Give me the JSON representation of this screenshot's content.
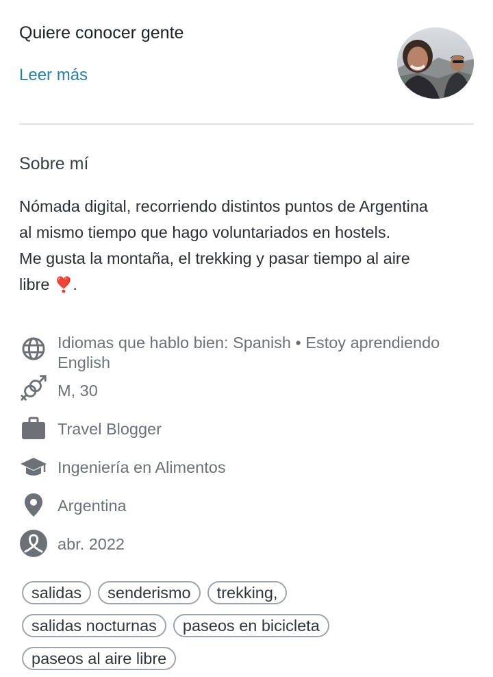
{
  "header": {
    "headline": "Quiere conocer gente",
    "read_more": "Leer más"
  },
  "about": {
    "title": "Sobre mí",
    "lines": [
      "Nómada digital, recorriendo distintos puntos de Argentina",
      "al mismo tiempo que hago voluntariados en hostels.",
      "Me gusta la montaña, el trekking y pasar tiempo al aire",
      "libre"
    ],
    "emoji": "❣️",
    "end": "."
  },
  "details": [
    {
      "icon": "globe-icon",
      "lines": [
        "Idiomas que hablo bien: Spanish • Estoy aprendiendo",
        "English"
      ]
    },
    {
      "icon": "gender-icon",
      "lines": [
        "M, 30"
      ]
    },
    {
      "icon": "briefcase-icon",
      "lines": [
        "Travel Blogger"
      ]
    },
    {
      "icon": "graduation-cap-icon",
      "lines": [
        "Ingeniería en Alimentos"
      ]
    },
    {
      "icon": "location-pin-icon",
      "lines": [
        "Argentina"
      ]
    },
    {
      "icon": "member-since-icon",
      "lines": [
        "abr. 2022"
      ]
    }
  ],
  "tags": [
    [
      "salidas",
      "senderismo",
      "trekking,"
    ],
    [
      "salidas nocturnas",
      "paseos en bicicleta"
    ],
    [
      "paseos al aire libre"
    ]
  ],
  "colors": {
    "link": "#2a7fa8",
    "icon": "#6c7178",
    "divider": "#dfe1e4",
    "tag_border": "#9ea3a8"
  }
}
